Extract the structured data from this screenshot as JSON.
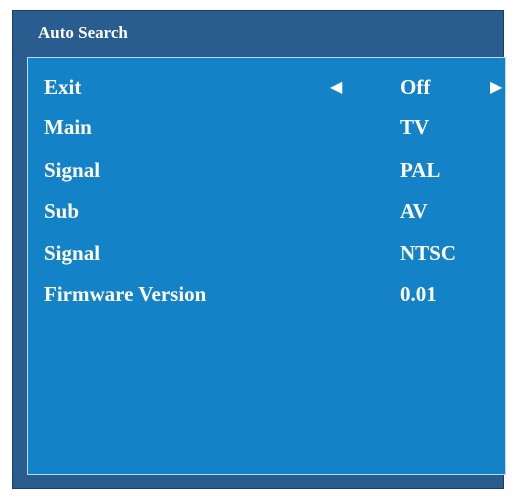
{
  "window": {
    "title": "Auto Search"
  },
  "menu": {
    "rows": [
      {
        "label": "Exit",
        "value": "Off"
      },
      {
        "label": "Main",
        "value": "TV"
      },
      {
        "label": "Signal",
        "value": "PAL"
      },
      {
        "label": "Sub",
        "value": "AV"
      },
      {
        "label": "Signal",
        "value": "NTSC"
      },
      {
        "label": "Firmware Version",
        "value": "0.01"
      }
    ],
    "arrows": {
      "left": "◀",
      "right": "▶"
    }
  },
  "colors": {
    "frame": "#2a5d8f",
    "panel": "#1482c6",
    "text": "#ffffff"
  }
}
